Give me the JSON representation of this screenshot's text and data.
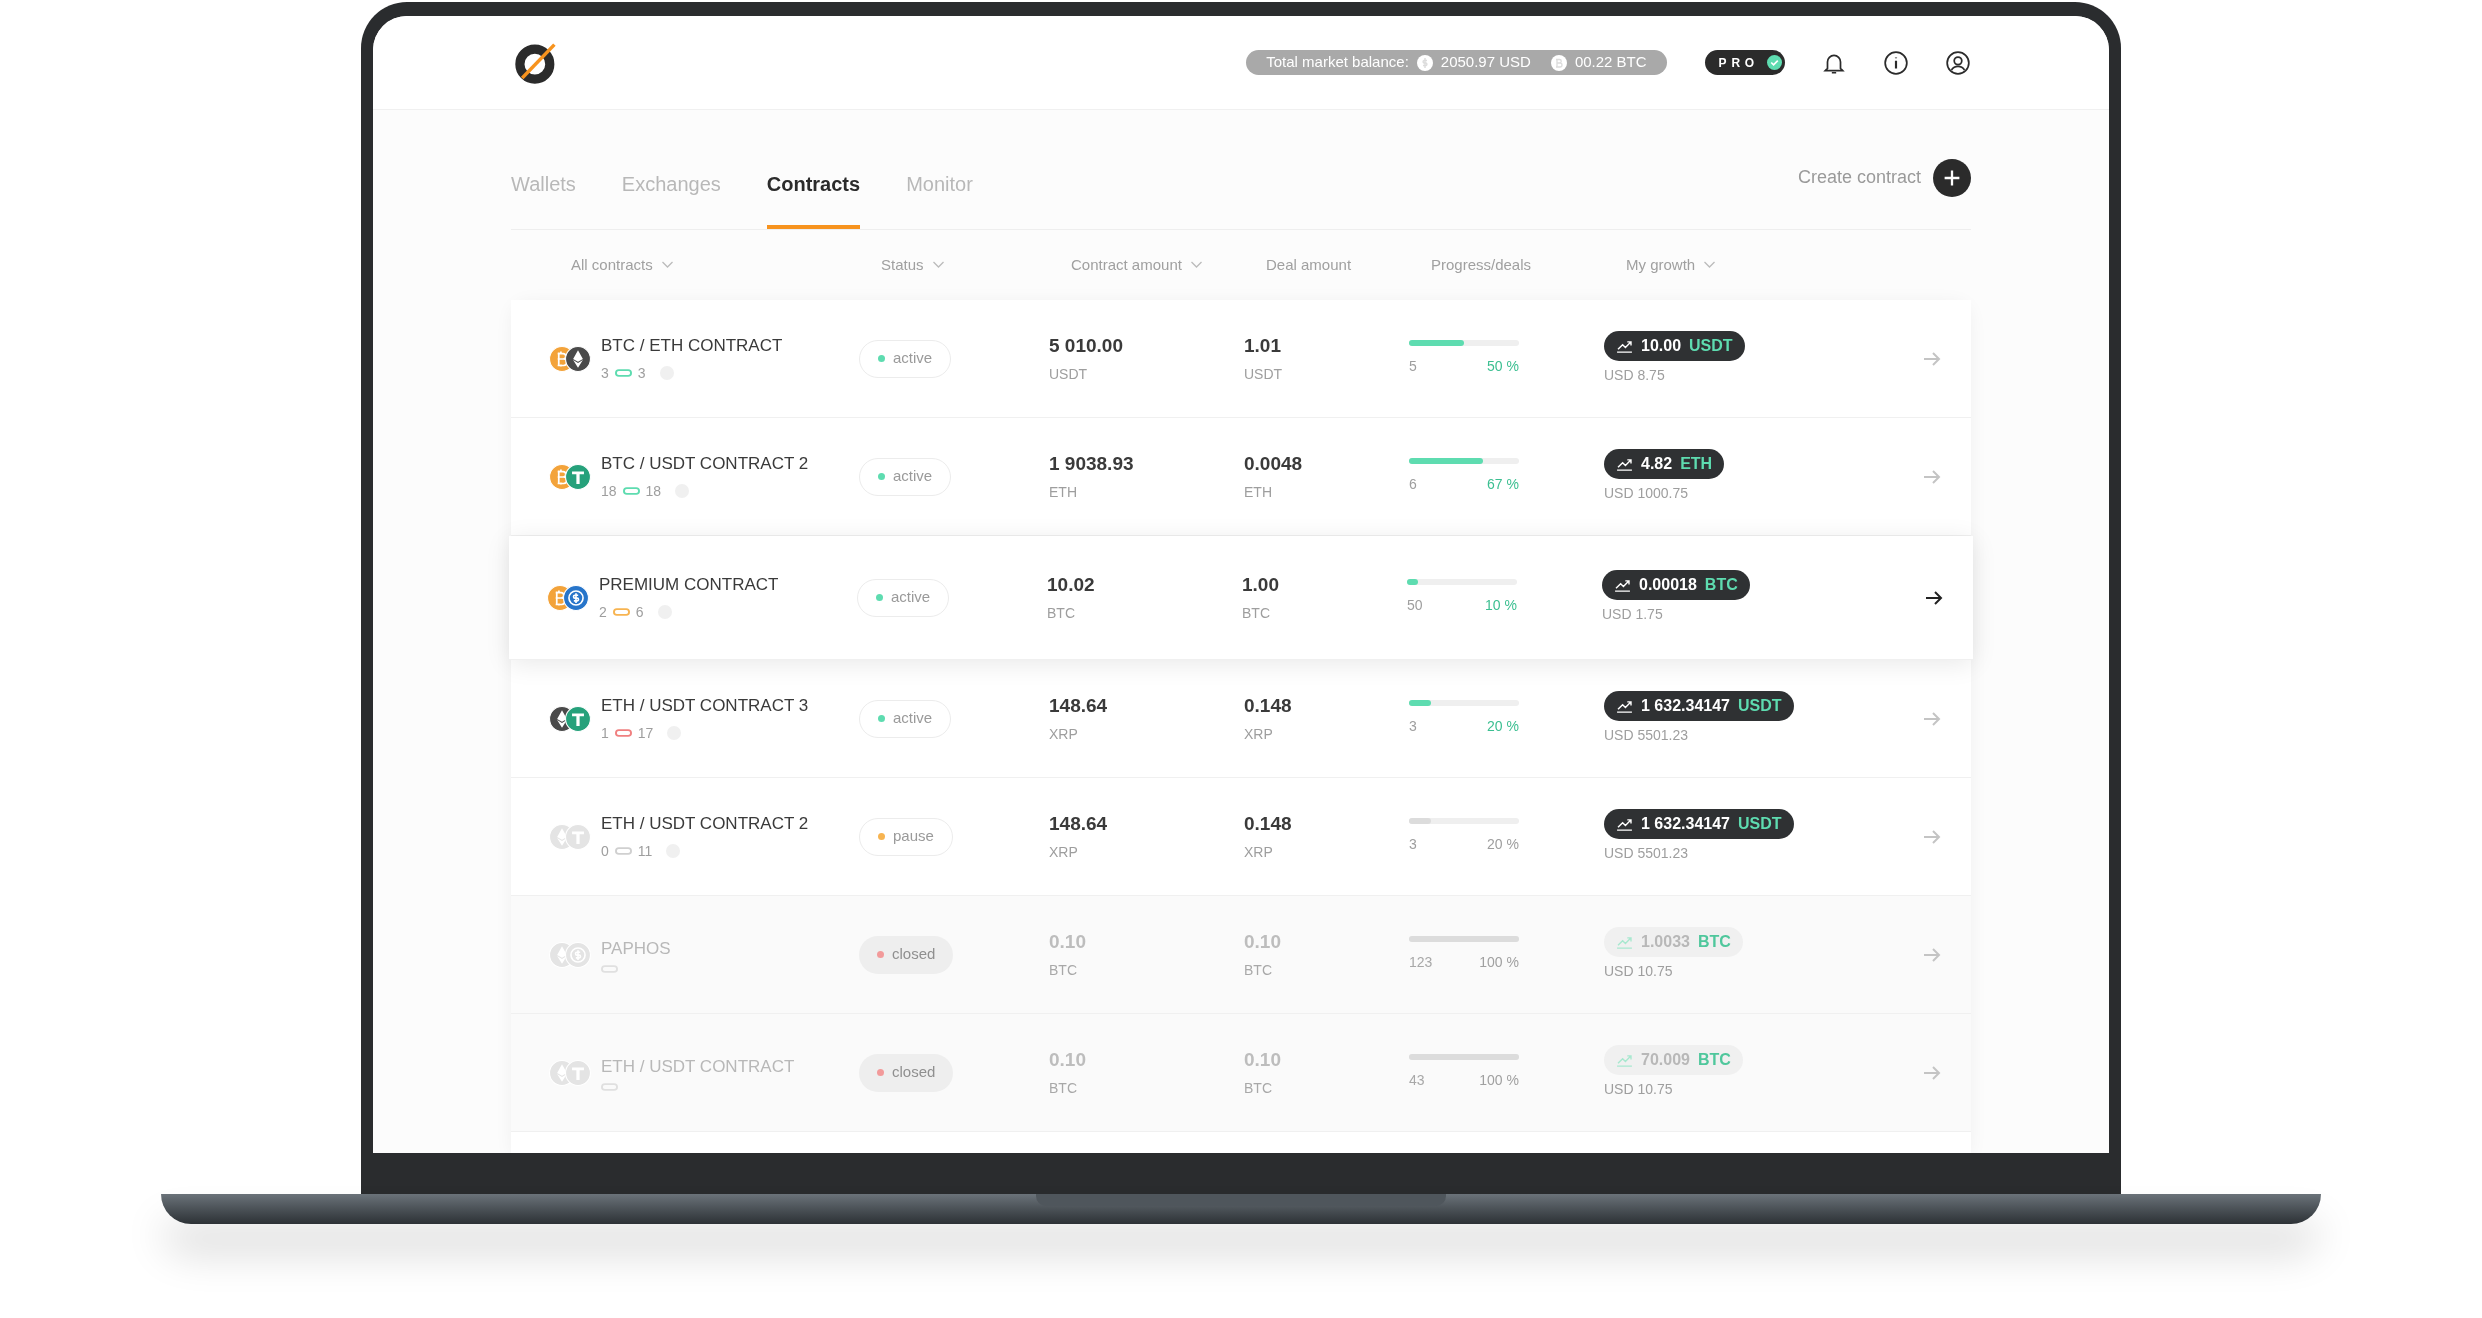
{
  "header": {
    "balance_label": "Total market balance:",
    "balance_usd": "2050.97 USD",
    "balance_btc": "00.22 BTC",
    "pro_badge": "PRO"
  },
  "tabs": [
    {
      "label": "Wallets",
      "selected": false
    },
    {
      "label": "Exchanges",
      "selected": false
    },
    {
      "label": "Contracts",
      "selected": true
    },
    {
      "label": "Monitor",
      "selected": false
    }
  ],
  "create_button": "Create contract",
  "columns": [
    {
      "label": "All contracts",
      "sortable": true
    },
    {
      "label": "Status",
      "sortable": true
    },
    {
      "label": "Contract amount",
      "sortable": true
    },
    {
      "label": "Deal amount",
      "sortable": false
    },
    {
      "label": "Progress/deals",
      "sortable": false
    },
    {
      "label": "My growth",
      "sortable": true
    }
  ],
  "rows": [
    {
      "name": "BTC / ETH CONTRACT",
      "coins": [
        {
          "kind": "btc"
        },
        {
          "kind": "eth"
        }
      ],
      "deposits": "3",
      "withdrawals": "3",
      "color": "#5edcb0",
      "status": "active",
      "kind": "active",
      "hovered": false,
      "amount": "5 010.00",
      "amount_unit": "USDT",
      "deal": "1.01",
      "deal_unit": "USDT",
      "level": 0.5,
      "deals": "5",
      "percent": "50 %",
      "growth": "10.00",
      "growth_currency": "USDT",
      "growth_usd": "USD 8.75"
    },
    {
      "name": "BTC / USDT CONTRACT 2",
      "coins": [
        {
          "kind": "btc"
        },
        {
          "kind": "usdt"
        }
      ],
      "deposits": "18",
      "withdrawals": "18",
      "color": "#5edcb0",
      "status": "active",
      "kind": "active",
      "hovered": false,
      "amount": "1 9038.93",
      "amount_unit": "ETH",
      "deal": "0.0048",
      "deal_unit": "ETH",
      "level": 0.67,
      "deals": "6",
      "percent": "67 %",
      "growth": "4.82",
      "growth_currency": "ETH",
      "growth_usd": "USD 1000.75"
    },
    {
      "name": "PREMIUM CONTRACT",
      "coins": [
        {
          "kind": "btc"
        },
        {
          "kind": "usdc"
        }
      ],
      "deposits": "2",
      "withdrawals": "6",
      "color": "#f7b451",
      "status": "active",
      "kind": "active",
      "hovered": true,
      "amount": "10.02",
      "amount_unit": "BTC",
      "deal": "1.00",
      "deal_unit": "BTC",
      "level": 0.1,
      "deals": "50",
      "percent": "10 %",
      "growth": "0.00018",
      "growth_currency": "BTC",
      "growth_usd": "USD 1.75"
    },
    {
      "name": "ETH / USDT CONTRACT 3",
      "coins": [
        {
          "kind": "eth"
        },
        {
          "kind": "usdt"
        }
      ],
      "deposits": "1",
      "withdrawals": "17",
      "color": "#f08080",
      "status": "active",
      "kind": "active",
      "hovered": false,
      "amount": "148.64",
      "amount_unit": "XRP",
      "deal": "0.148",
      "deal_unit": "XRP",
      "level": 0.2,
      "deals": "3",
      "percent": "20 %",
      "growth": "1 632.34147",
      "growth_currency": "USDT",
      "growth_usd": "USD 5501.23"
    },
    {
      "name": "ETH / USDT CONTRACT 2",
      "coins": [
        {
          "kind": "eth"
        },
        {
          "kind": "usdt"
        }
      ],
      "deposits": "0",
      "withdrawals": "11",
      "color": "#d0d0d0",
      "status": "pause",
      "kind": "pause",
      "hovered": false,
      "amount": "148.64",
      "amount_unit": "XRP",
      "deal": "0.148",
      "deal_unit": "XRP",
      "level": 0.2,
      "deals": "3",
      "percent": "20 %",
      "growth": "1 632.34147",
      "growth_currency": "USDT",
      "growth_usd": "USD 5501.23"
    },
    {
      "name": "PAPHOS",
      "coins": [
        {
          "kind": "eth"
        },
        {
          "kind": "usdc"
        }
      ],
      "color": "#e0e0e0",
      "status": "closed",
      "kind": "closed",
      "hovered": false,
      "amount": "0.10",
      "amount_unit": "BTC",
      "deal": "0.10",
      "deal_unit": "BTC",
      "level": 1,
      "deals": "123",
      "percent": "100 %",
      "growth": "1.0033",
      "growth_currency": "BTC",
      "growth_usd": "USD 10.75"
    },
    {
      "name": "ETH / USDT CONTRACT",
      "coins": [
        {
          "kind": "eth"
        },
        {
          "kind": "usdt"
        }
      ],
      "color": "#e0e0e0",
      "status": "closed",
      "kind": "closed",
      "hovered": false,
      "amount": "0.10",
      "amount_unit": "BTC",
      "deal": "0.10",
      "deal_unit": "BTC",
      "level": 1,
      "deals": "43",
      "percent": "100 %",
      "growth": "70.009",
      "growth_currency": "BTC",
      "growth_usd": "USD 10.75"
    }
  ]
}
